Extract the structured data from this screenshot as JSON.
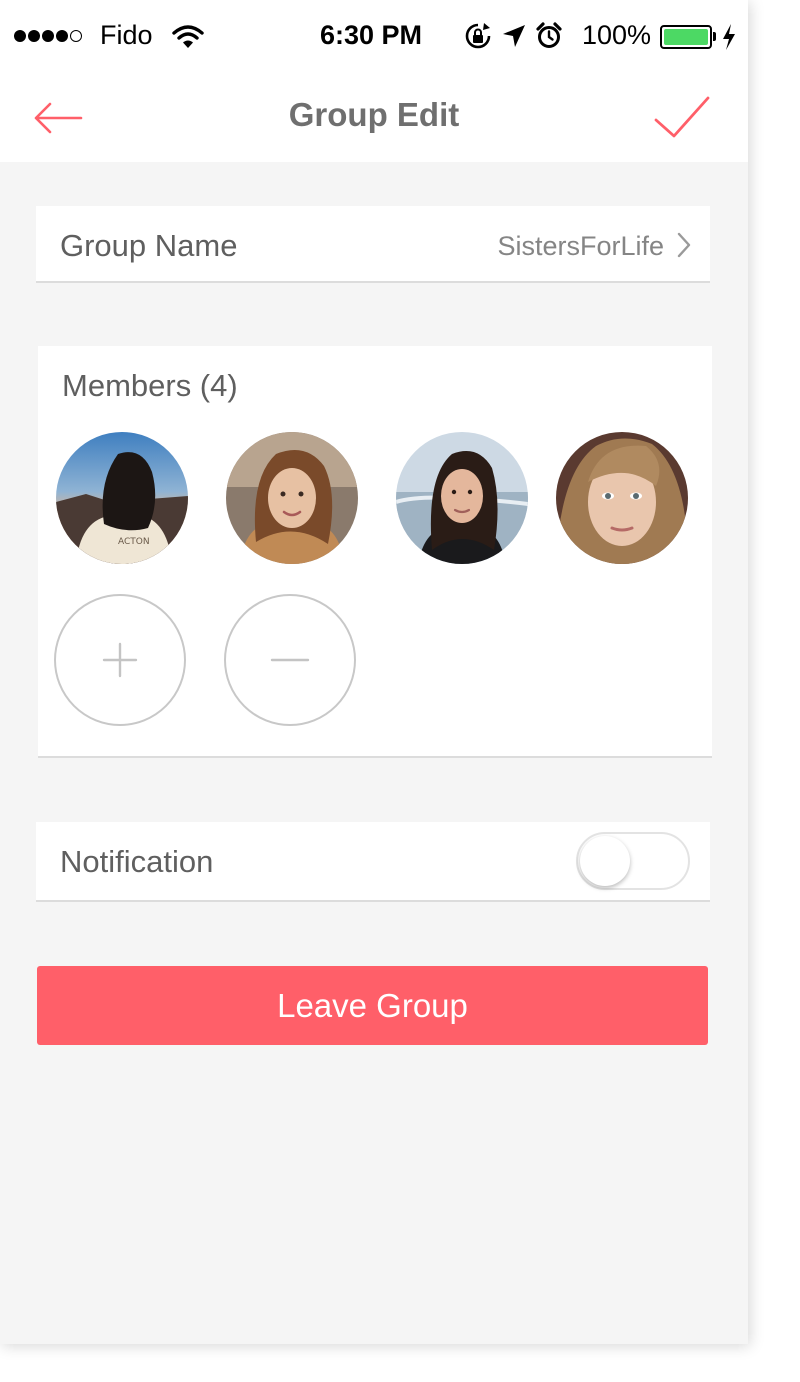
{
  "status_bar": {
    "carrier": "Fido",
    "time": "6:30 PM",
    "battery_percent": "100%",
    "signal_bars_filled": 4,
    "signal_bars_total": 5,
    "battery_level": 1.0
  },
  "nav": {
    "title": "Group Edit",
    "back_icon": "arrow-left-icon",
    "done_icon": "checkmark-icon",
    "accent_color": "#ff5f69"
  },
  "group_name": {
    "label": "Group Name",
    "value": "SistersForLife"
  },
  "members": {
    "title": "Members (4)",
    "count": 4,
    "avatars": [
      "member-1",
      "member-2",
      "member-3",
      "member-4"
    ],
    "add_icon": "plus-icon",
    "remove_icon": "minus-icon"
  },
  "notification": {
    "label": "Notification",
    "enabled": false
  },
  "leave_button": {
    "label": "Leave Group",
    "color": "#ff5f69"
  }
}
